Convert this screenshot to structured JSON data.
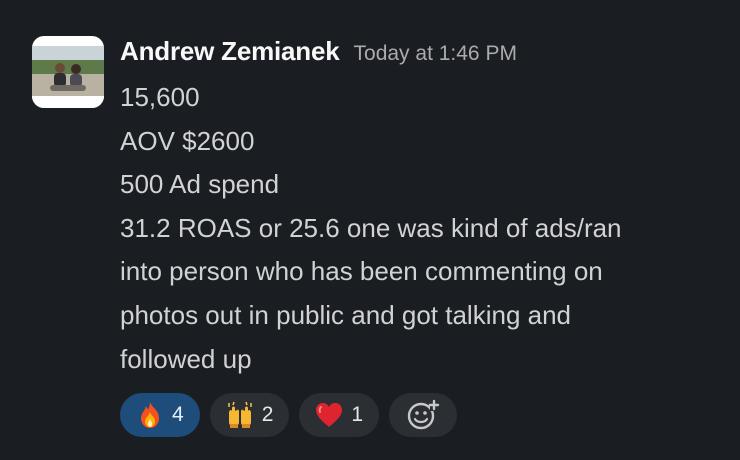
{
  "message": {
    "author": "Andrew Zemianek",
    "timestamp": "Today at 1:46 PM",
    "lines": [
      "15,600",
      "AOV $2600",
      "500 Ad spend",
      "31.2 ROAS or 25.6 one was kind of ads/ran",
      "into person who has been commenting on",
      "photos out in public and got talking and",
      "followed up"
    ]
  },
  "reactions": [
    {
      "icon": "fire-emoji-icon",
      "count": "4",
      "active": true
    },
    {
      "icon": "raising-hands-emoji-icon",
      "count": "2",
      "active": false
    },
    {
      "icon": "red-heart-emoji-icon",
      "count": "1",
      "active": false
    }
  ],
  "add_reaction": {
    "icon": "add-reaction-icon"
  },
  "colors": {
    "background": "#1a1d21",
    "active_reaction": "#1e4d7b",
    "reaction_bg": "#2b2e33"
  }
}
